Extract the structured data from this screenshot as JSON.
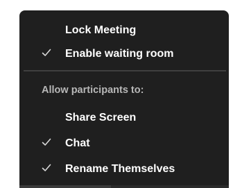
{
  "menu": {
    "items_top": [
      {
        "label": "Lock Meeting",
        "checked": false
      },
      {
        "label": "Enable waiting room",
        "checked": true
      }
    ],
    "section_header": "Allow participants to:",
    "items_bottom": [
      {
        "label": "Share Screen",
        "checked": false
      },
      {
        "label": "Chat",
        "checked": true
      },
      {
        "label": "Rename Themselves",
        "checked": true
      }
    ]
  },
  "colors": {
    "menu_background": "#1f1f1f",
    "text": "#ffffff",
    "header_text": "#b8b8b8",
    "divider": "#3f3f3f"
  },
  "icons": {
    "check": "check-icon"
  }
}
